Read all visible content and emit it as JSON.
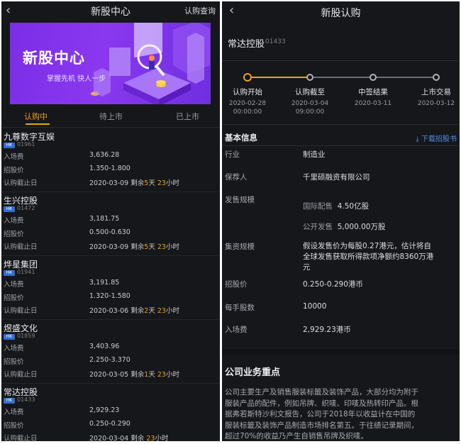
{
  "left": {
    "title": "新股中心",
    "action": "认购查询",
    "banner": {
      "title": "新股中心",
      "subtitle": "掌握先机 快人一步"
    },
    "tabs": [
      {
        "label": "认购中",
        "active": true
      },
      {
        "label": "待上市",
        "active": false
      },
      {
        "label": "已上市",
        "active": false
      }
    ],
    "field_labels": {
      "fee": "入场费",
      "price": "招股价",
      "deadline": "认购截止日"
    },
    "remain_label": "剩余",
    "day_unit": "天",
    "hour_unit": "小时",
    "stocks": [
      {
        "name": "九尊数字互娱",
        "market": "HK",
        "code": "01961",
        "fee": "3,636.28",
        "price": "1.350-1.800",
        "deadline": "2020-03-09",
        "days": "5",
        "hours": "23"
      },
      {
        "name": "生兴控股",
        "market": "HK",
        "code": "01472",
        "fee": "3,181.75",
        "price": "0.500-0.630",
        "deadline": "2020-03-09",
        "days": "5",
        "hours": "23"
      },
      {
        "name": "烨星集团",
        "market": "HK",
        "code": "01941",
        "fee": "3,191.85",
        "price": "1.320-1.580",
        "deadline": "2020-03-06",
        "days": "2",
        "hours": "23"
      },
      {
        "name": "煜盛文化",
        "market": "HK",
        "code": "01859",
        "fee": "3,403.96",
        "price": "2.250-3.370",
        "deadline": "2020-03-05",
        "days": "1",
        "hours": "23"
      },
      {
        "name": "常达控股",
        "market": "HK",
        "code": "01433",
        "fee": "2,929.23",
        "price": "0.250-0.290",
        "deadline": "2020-03-04",
        "days": "",
        "hours": "23"
      }
    ]
  },
  "right": {
    "title": "新股认购",
    "stock": {
      "name": "常达控股",
      "code": "01433"
    },
    "timeline": [
      {
        "label": "认购开始",
        "date": "2020-02-28",
        "time": "00:00:00"
      },
      {
        "label": "认购截至",
        "date": "2020-03-04",
        "time": "09:00:00"
      },
      {
        "label": "中签结果",
        "date": "2020-03-11",
        "time": ""
      },
      {
        "label": "上市交易",
        "date": "2020-03-12",
        "time": ""
      }
    ],
    "info_title": "基本信息",
    "download_label": "下载招股书",
    "info": {
      "industry_label": "行业",
      "industry": "制造业",
      "sponsor_label": "保荐人",
      "sponsor": "千里硕融资有限公司",
      "size_label": "发售规模",
      "intl_label": "国际配售",
      "intl": "4.50亿股",
      "public_label": "公开发售",
      "public": "5,000.00万股",
      "fund_label": "集资规模",
      "fund_line1": "假设发售价为每股0.27港元，估计将自",
      "fund_line2": "全球发售获取所得款项净额约8360万港",
      "fund_line3": "元",
      "price_label": "招股价",
      "price": "0.250-0.290港币",
      "lot_label": "每手股数",
      "lot": "10000",
      "fee_label": "入场费",
      "fee": "2,929.23港币"
    },
    "business_title": "公司业务重点",
    "business_lines": [
      "公司主要生产及销售服装标籤及装饰产品，大部分均为附于",
      "服装产品的配件，例如吊牌、织唛、印唛及热转印产品。根",
      "据弗若斯特沙利文报告，公司于2018年以收益计在中国的",
      "服装标籤及装饰产品制造市场排名第五。于往绩记录期间，",
      "超过70%的收益乃产生自销售吊牌及织唛。"
    ]
  },
  "colors": {
    "accent": "#e9a21e",
    "banner": "#7a2ee6",
    "link": "#4f8fe6",
    "background": "#16171b"
  },
  "icons": {
    "back": "chevron-left-icon",
    "download": "download-icon"
  }
}
